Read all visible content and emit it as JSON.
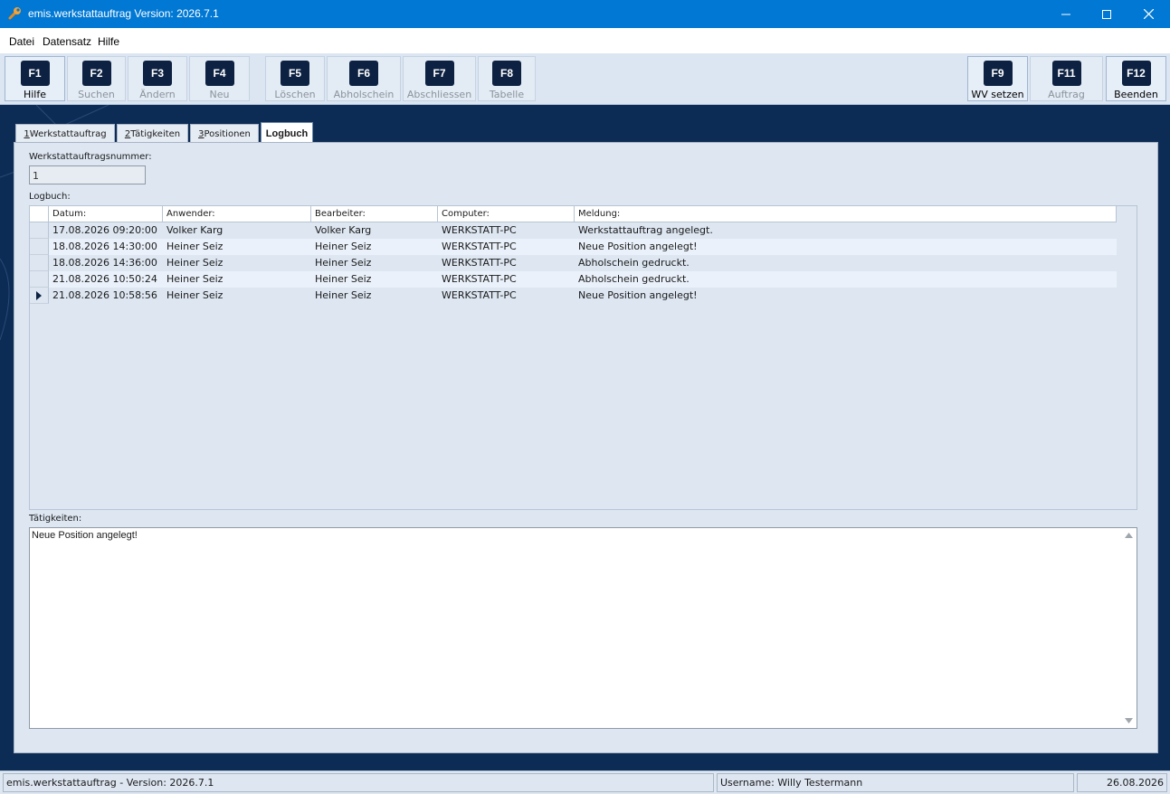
{
  "window": {
    "title": "emis.werkstattauftrag Version: 2026.7.1"
  },
  "menu": {
    "items": [
      "Datei",
      "Datensatz",
      "Hilfe"
    ]
  },
  "toolbar": {
    "buttons": [
      {
        "key": "F1",
        "label": "Hilfe"
      },
      {
        "key": "F2",
        "label": "Suchen"
      },
      {
        "key": "F3",
        "label": "Ändern"
      },
      {
        "key": "F4",
        "label": "Neu"
      },
      {
        "key": "F5",
        "label": "Löschen"
      },
      {
        "key": "F6",
        "label": "Abholschein"
      },
      {
        "key": "F7",
        "label": "Abschliessen"
      },
      {
        "key": "F8",
        "label": "Tabelle"
      },
      {
        "key": "F9",
        "label": "WV setzen"
      },
      {
        "key": "F11",
        "label": "Auftrag"
      },
      {
        "key": "F12",
        "label": "Beenden"
      }
    ]
  },
  "tabs": [
    {
      "hotkey": "1",
      "label": " Werkstattauftrag"
    },
    {
      "hotkey": "2",
      "label": " Tätigkeiten"
    },
    {
      "hotkey": "3",
      "label": " Positionen"
    },
    {
      "hotkey": "",
      "label": "Logbuch"
    }
  ],
  "form": {
    "order_number_label": "Werkstattauftragsnummer:",
    "order_number_value": "1",
    "log_label": "Logbuch:",
    "activities_label": "Tätigkeiten:",
    "activities_text": "Neue Position angelegt!"
  },
  "log_table": {
    "columns": [
      "Datum:",
      "Anwender:",
      "Bearbeiter:",
      "Computer:",
      "Meldung:"
    ],
    "rows": [
      [
        "17.08.2026 09:20:00",
        "Volker Karg",
        "Volker Karg",
        "WERKSTATT-PC",
        "Werkstattauftrag angelegt."
      ],
      [
        "18.08.2026 14:30:00",
        "Heiner Seiz",
        "Heiner Seiz",
        "WERKSTATT-PC",
        "Neue Position angelegt!"
      ],
      [
        "18.08.2026 14:36:00",
        "Heiner Seiz",
        "Heiner Seiz",
        "WERKSTATT-PC",
        "Abholschein gedruckt."
      ],
      [
        "21.08.2026 10:50:24",
        "Heiner Seiz",
        "Heiner Seiz",
        "WERKSTATT-PC",
        "Abholschein gedruckt."
      ],
      [
        "21.08.2026 10:58:56",
        "Heiner Seiz",
        "Heiner Seiz",
        "WERKSTATT-PC",
        "Neue Position angelegt!"
      ]
    ],
    "current_row": 5
  },
  "statusbar": {
    "app": "emis.werkstattauftrag - Version: 2026.7.1",
    "user": "Username: Willy Testermann",
    "date": "26.08.2026"
  },
  "colors": {
    "titlebar": "#0078d4",
    "toolbar_bg": "#dce6f2",
    "key_badge": "#0d2242",
    "workspace_bg": "#0d2c55",
    "panel_bg": "#dde6f1"
  }
}
